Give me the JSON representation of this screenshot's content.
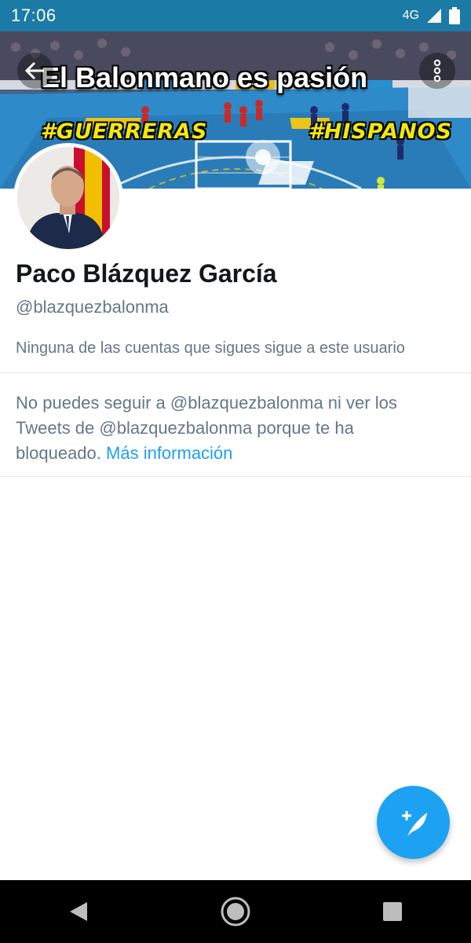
{
  "status_bar": {
    "time": "17:06",
    "network": "4G",
    "icons": [
      "signal-icon",
      "battery-icon"
    ],
    "background": "#1b7aa6"
  },
  "banner": {
    "title": "El Balonmano es pasión",
    "tag_left": "#GUERRERAS",
    "tag_right": "#HISPANOS",
    "icons": [
      "back-arrow-icon",
      "more-vertical-icon"
    ]
  },
  "profile": {
    "name": "Paco Blázquez García",
    "handle": "@blazquezbalonma",
    "followers_note": "Ninguna de las cuentas que sigues sigue a este usuario"
  },
  "blocked": {
    "message": "No puedes seguir a @blazquezbalonma ni ver los Tweets de @blazquezbalonma porque te ha bloqueado.",
    "link_text": "Más información",
    "link_color": "#1da1f2"
  },
  "fab": {
    "icon": "compose-tweet-icon",
    "color": "#1da1f2"
  },
  "nav_bar": {
    "icons": [
      "nav-back-icon",
      "nav-home-icon",
      "nav-recents-icon"
    ]
  }
}
